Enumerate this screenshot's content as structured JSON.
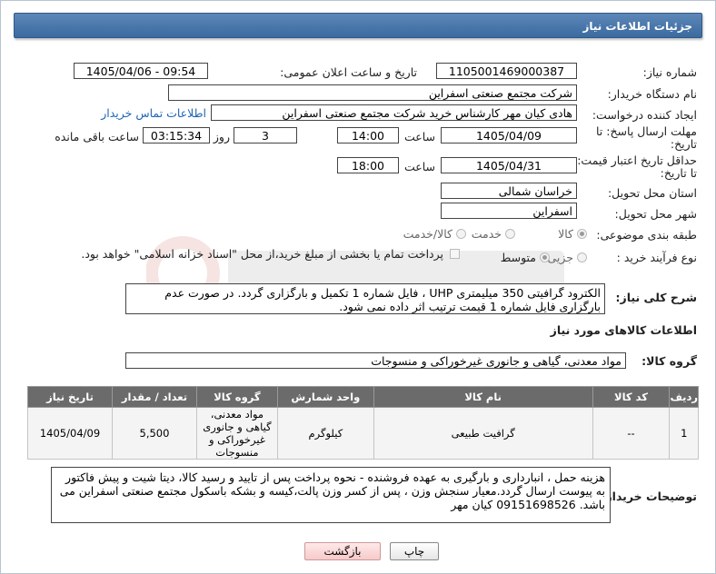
{
  "header": {
    "title": "جزئیات اطلاعات نیاز"
  },
  "fields": {
    "need_number_label": "شماره نیاز:",
    "need_number": "1105001469000387",
    "announce_label": "تاریخ و ساعت اعلان عمومی:",
    "announce_value": "1405/04/06 - 09:54",
    "buyer_org_label": "نام دستگاه خریدار:",
    "buyer_org": "شرکت مجتمع صنعتی اسفراین",
    "creator_label": "ایجاد کننده درخواست:",
    "creator": "هادی کیان مهر کارشناس خرید شرکت مجتمع صنعتی اسفراین",
    "contact_link": "اطلاعات تماس خریدار",
    "deadline_label_1": "مهلت ارسال پاسخ: تا",
    "deadline_label_2": "تاریخ:",
    "deadline_date": "1405/04/09",
    "time_label": "ساعت",
    "deadline_time": "14:00",
    "days_value": "3",
    "days_label": "روز و",
    "remaining_time": "03:15:34",
    "remaining_label": "ساعت باقی مانده",
    "validity_label_1": "حداقل تاریخ اعتبار قیمت:",
    "validity_label_2": "تا تاریخ:",
    "validity_date": "1405/04/31",
    "validity_time": "18:00",
    "province_label": "استان محل تحویل:",
    "province": "خراسان شمالی",
    "city_label": "شهر محل تحویل:",
    "city": "اسفراین",
    "category_label": "طبقه بندی موضوعی:",
    "category_options": [
      "کالا",
      "خدمت",
      "کالا/خدمت"
    ],
    "process_label": "نوع فرآیند خرید :",
    "process_options": [
      "جزیی",
      "متوسط"
    ],
    "payment_note": "پرداخت تمام یا بخشی از مبلغ خرید،از محل \"اسناد خزانه اسلامی\" خواهد بود."
  },
  "description": {
    "label": "شرح کلی نیاز:",
    "text": "الکترود گرافیتی 350 میلیمتری UHP ، فایل شماره 1 تکمیل و بارگزاری گردد. در صورت عدم بارگزاری فایل شماره 1 قیمت ترتیب اثر داده نمی شود."
  },
  "goods": {
    "section_title": "اطلاعات کالاهای مورد نیاز",
    "group_label": "گروه کالا:",
    "group_value": "مواد معدنی، گیاهی و جانوری غیرخوراکی و منسوجات",
    "columns": [
      "ردیف",
      "کد کالا",
      "نام کالا",
      "واحد شمارش",
      "گروه کالا",
      "تعداد / مقدار",
      "تاریخ نیاز"
    ],
    "rows": [
      {
        "row": "1",
        "code": "--",
        "name": "گرافیت طبیعی",
        "unit": "کیلوگرم",
        "group": "مواد معدنی، گیاهی و جانوری غیرخوراکی و منسوجات",
        "qty": "5,500",
        "date": "1405/04/09"
      }
    ]
  },
  "notes": {
    "label": "توضیحات خریدار:",
    "text": "هزینه حمل ، انبارداری و بارگیری به عهده فروشنده - نحوه پرداخت پس از تایید و رسید کالا، دیتا شیت و پیش فاکتور به پیوست ارسال گردد.معیار سنجش وزن ، پس از کسر وزن پالت،کیسه و بشکه باسکول مجتمع صنعتی اسفراین می باشد. 09151698526 کیان مهر"
  },
  "buttons": {
    "print": "چاپ",
    "back": "بازگشت"
  }
}
